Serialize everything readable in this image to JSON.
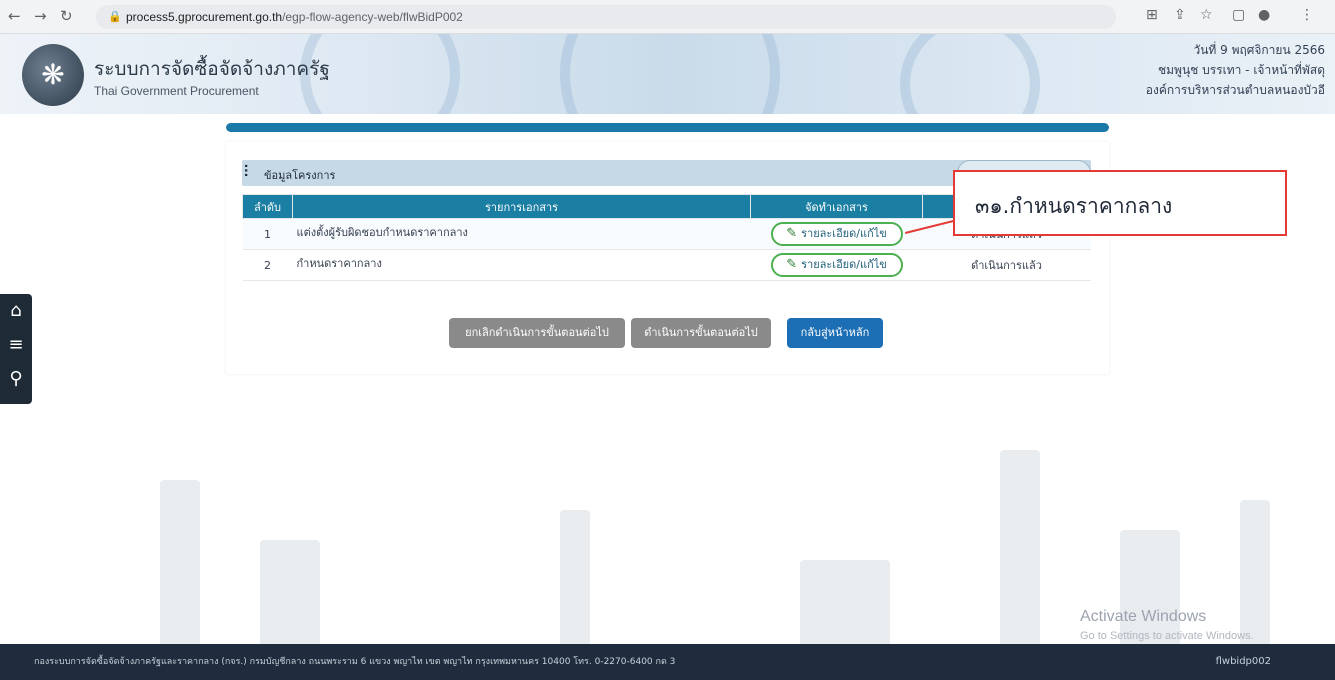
{
  "browser": {
    "url_host": "process5.gprocurement.go.th",
    "url_path": "/egp-flow-agency-web/flwBidP002"
  },
  "header": {
    "title": "ระบบการจัดซื้อจัดจ้างภาครัฐ",
    "subtitle": "Thai Government Procurement",
    "date": "วันที่ 9 พฤศจิกายน 2566",
    "user": "ชมพูนุช บรรเทา - เจ้าหน้าที่พัสดุ",
    "org": "องค์การบริหารส่วนตำบลหนองบัวอี"
  },
  "progress": {
    "value": 1.0
  },
  "panel": {
    "title": "ข้อมูลโครงการ",
    "columns": {
      "no": "ลำดับ",
      "name": "รายการเอกสาร",
      "action": "จัดทำเอกสาร",
      "status": ""
    },
    "rows": [
      {
        "no": "1",
        "name": "แต่งตั้งผู้รับผิดชอบกำหนดราคากลาง",
        "action": "รายละเอียด/แก้ไข",
        "status": "ดำเนินการแล้ว"
      },
      {
        "no": "2",
        "name": "กำหนดราคากลาง",
        "action": "รายละเอียด/แก้ไข",
        "status": "ดำเนินการแล้ว"
      }
    ],
    "buttons": {
      "cancel_next": "ยกเลิกดำเนินการขั้นตอนต่อไป",
      "next": "ดำเนินการขั้นตอนต่อไป",
      "home": "กลับสู่หน้าหลัก"
    }
  },
  "callout": {
    "text": "๓๑.กำหนดราคากลาง"
  },
  "watermark": {
    "title": "Activate Windows",
    "sub": "Go to Settings to activate Windows."
  },
  "footer": {
    "text": "กองระบบการจัดซื้อจัดจ้างภาครัฐและราคากลาง (กจร.) กรมบัญชีกลาง ถนนพระราม 6 แขวง พญาไท เขต พญาไท กรุงเทพมหานคร 10400 โทร. 0-2270-6400 กด 3",
    "code": "flwbidp002"
  },
  "colors": {
    "primary": "#1b7fa3",
    "footer": "#1e2c3d",
    "callout_border": "#e53935"
  }
}
